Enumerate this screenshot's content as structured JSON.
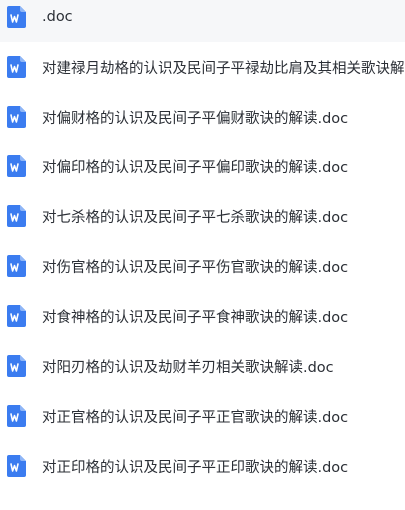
{
  "file_list": {
    "icon_color": "#3b7cf0",
    "selected_row_bg": "#f6f7f9",
    "items": [
      {
        "name": ".doc",
        "icon": "word-doc-icon"
      },
      {
        "name": "对建禄月劫格的认识及民间子平禄劫比肩及其相关歌诀解",
        "icon": "word-doc-icon"
      },
      {
        "name": "对偏财格的认识及民间子平偏财歌诀的解读.doc",
        "icon": "word-doc-icon"
      },
      {
        "name": "对偏印格的认识及民间子平偏印歌诀的解读.doc",
        "icon": "word-doc-icon"
      },
      {
        "name": "对七杀格的认识及民间子平七杀歌诀的解读.doc",
        "icon": "word-doc-icon"
      },
      {
        "name": "对伤官格的认识及民间子平伤官歌诀的解读.doc",
        "icon": "word-doc-icon"
      },
      {
        "name": "对食神格的认识及民间子平食神歌诀的解读.doc",
        "icon": "word-doc-icon"
      },
      {
        "name": "对阳刃格的认识及劫财羊刃相关歌诀解读.doc",
        "icon": "word-doc-icon"
      },
      {
        "name": "对正官格的认识及民间子平正官歌诀的解读.doc",
        "icon": "word-doc-icon"
      },
      {
        "name": "对正印格的认识及民间子平正印歌诀的解读.doc",
        "icon": "word-doc-icon"
      }
    ]
  }
}
